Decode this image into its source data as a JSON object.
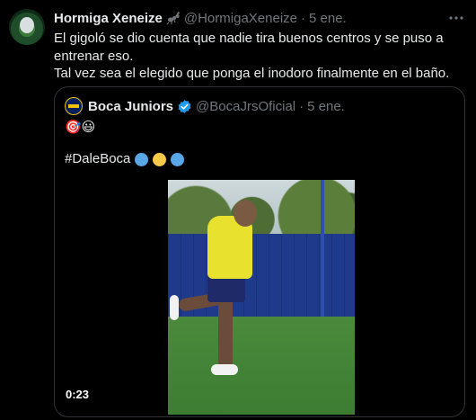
{
  "tweet": {
    "author_name": "Hormiga Xeneize",
    "handle": "@HormigaXeneize",
    "separator": "·",
    "date": "5 ene.",
    "lines": [
      "El gigoló se dio cuenta que nadie tira buenos centros y se puso a entrenar eso.",
      "Tal vez sea el elegido que ponga el inodoro finalmente en el baño."
    ]
  },
  "quoted": {
    "author_name": "Boca Juniors",
    "handle": "@BocaJrsOficial",
    "separator": "·",
    "date": "5 ene.",
    "emojis": "🎯😃",
    "hashtag": "#DaleBoca",
    "circles": [
      "#5aa7e8",
      "#f7c948",
      "#5aa7e8"
    ],
    "video_time": "0:23"
  },
  "colors": {
    "background": "#000000",
    "text": "#e7e9ea",
    "muted": "#71767b",
    "verified": "#1d9bf0",
    "border": "#2f3336"
  },
  "icons": {
    "author_badge": "ant-icon",
    "verified": "verified-badge-icon",
    "more": "more-horizontal-icon"
  }
}
